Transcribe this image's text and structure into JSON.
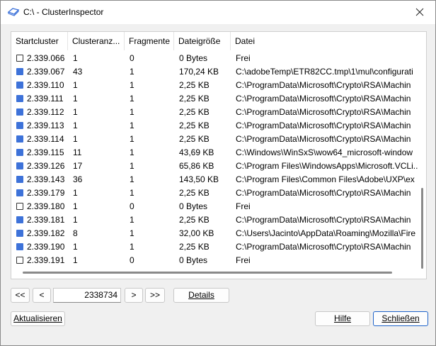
{
  "window": {
    "title": "C:\\ - ClusterInspector"
  },
  "table": {
    "headers": [
      "Startcluster",
      "Clusteranz...",
      "Fragmente",
      "Dateigröße",
      "Datei"
    ],
    "rows": [
      {
        "checked": false,
        "start": "2.339.066",
        "clusters": "1",
        "fragments": "0",
        "size": "0 Bytes",
        "file": "Frei"
      },
      {
        "checked": true,
        "start": "2.339.067",
        "clusters": "43",
        "fragments": "1",
        "size": "170,24 KB",
        "file": "C:\\adobeTemp\\ETR82CC.tmp\\1\\mul\\configurati"
      },
      {
        "checked": true,
        "start": "2.339.110",
        "clusters": "1",
        "fragments": "1",
        "size": "2,25 KB",
        "file": "C:\\ProgramData\\Microsoft\\Crypto\\RSA\\Machin"
      },
      {
        "checked": true,
        "start": "2.339.111",
        "clusters": "1",
        "fragments": "1",
        "size": "2,25 KB",
        "file": "C:\\ProgramData\\Microsoft\\Crypto\\RSA\\Machin"
      },
      {
        "checked": true,
        "start": "2.339.112",
        "clusters": "1",
        "fragments": "1",
        "size": "2,25 KB",
        "file": "C:\\ProgramData\\Microsoft\\Crypto\\RSA\\Machin"
      },
      {
        "checked": true,
        "start": "2.339.113",
        "clusters": "1",
        "fragments": "1",
        "size": "2,25 KB",
        "file": "C:\\ProgramData\\Microsoft\\Crypto\\RSA\\Machin"
      },
      {
        "checked": true,
        "start": "2.339.114",
        "clusters": "1",
        "fragments": "1",
        "size": "2,25 KB",
        "file": "C:\\ProgramData\\Microsoft\\Crypto\\RSA\\Machin"
      },
      {
        "checked": true,
        "start": "2.339.115",
        "clusters": "11",
        "fragments": "1",
        "size": "43,69 KB",
        "file": "C:\\Windows\\WinSxS\\wow64_microsoft-window"
      },
      {
        "checked": true,
        "start": "2.339.126",
        "clusters": "17",
        "fragments": "1",
        "size": "65,86 KB",
        "file": "C:\\Program Files\\WindowsApps\\Microsoft.VCLi.."
      },
      {
        "checked": true,
        "start": "2.339.143",
        "clusters": "36",
        "fragments": "1",
        "size": "143,50 KB",
        "file": "C:\\Program Files\\Common Files\\Adobe\\UXP\\ex"
      },
      {
        "checked": true,
        "start": "2.339.179",
        "clusters": "1",
        "fragments": "1",
        "size": "2,25 KB",
        "file": "C:\\ProgramData\\Microsoft\\Crypto\\RSA\\Machin"
      },
      {
        "checked": false,
        "start": "2.339.180",
        "clusters": "1",
        "fragments": "0",
        "size": "0 Bytes",
        "file": "Frei"
      },
      {
        "checked": true,
        "start": "2.339.181",
        "clusters": "1",
        "fragments": "1",
        "size": "2,25 KB",
        "file": "C:\\ProgramData\\Microsoft\\Crypto\\RSA\\Machin"
      },
      {
        "checked": true,
        "start": "2.339.182",
        "clusters": "8",
        "fragments": "1",
        "size": "32,00 KB",
        "file": "C:\\Users\\Jacinto\\AppData\\Roaming\\Mozilla\\Fire"
      },
      {
        "checked": true,
        "start": "2.339.190",
        "clusters": "1",
        "fragments": "1",
        "size": "2,25 KB",
        "file": "C:\\ProgramData\\Microsoft\\Crypto\\RSA\\Machin"
      },
      {
        "checked": false,
        "start": "2.339.191",
        "clusters": "1",
        "fragments": "0",
        "size": "0 Bytes",
        "file": "Frei"
      }
    ]
  },
  "nav": {
    "first": "<<",
    "prev": "<",
    "cluster_value": "2338734",
    "next": ">",
    "last": ">>",
    "details": "Details"
  },
  "footer": {
    "refresh": "Aktualisieren",
    "help": "Hilfe",
    "close": "Schließen"
  },
  "colors": {
    "accent": "#3d72d9",
    "primary_border": "#1f63c9"
  },
  "icons": {
    "app": "disk-outline-icon",
    "close": "close-icon"
  }
}
